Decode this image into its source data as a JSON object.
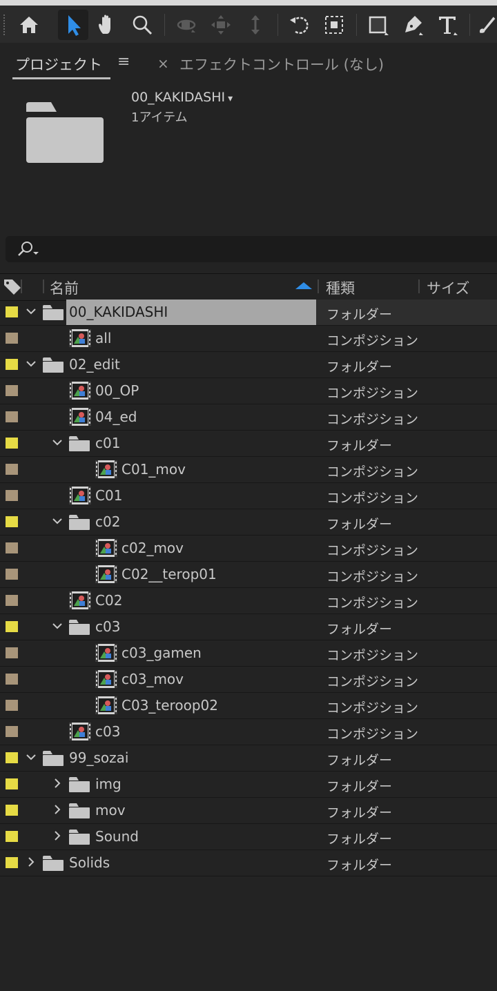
{
  "colors": {
    "label_folder": "#e6db45",
    "label_comp": "#a8957a",
    "accent": "#2f8de6",
    "selection": "#a7a7a7"
  },
  "toolbar": {
    "tools": [
      {
        "name": "home-icon"
      },
      {
        "name": "selection-tool-icon",
        "active": true
      },
      {
        "name": "hand-tool-icon"
      },
      {
        "name": "zoom-tool-icon"
      },
      {
        "name": "orbit-camera-icon"
      },
      {
        "name": "pan-camera-icon"
      },
      {
        "name": "dolly-camera-icon"
      },
      {
        "name": "rotate-tool-icon"
      },
      {
        "name": "pan-behind-icon"
      },
      {
        "name": "rectangle-tool-icon"
      },
      {
        "name": "pen-tool-icon"
      },
      {
        "name": "type-tool-icon"
      },
      {
        "name": "brush-tool-icon"
      }
    ]
  },
  "panel": {
    "project_tab": "プロジェクト",
    "menu_glyph": "≡",
    "close_glyph": "×",
    "effect_tab": "エフェクトコントロール (なし)"
  },
  "info": {
    "name": "00_KAKIDASHI",
    "caret": "▾",
    "count": "1アイテム"
  },
  "columns": {
    "name": "名前",
    "type": "種類",
    "size": "サイズ"
  },
  "rows": [
    {
      "name": "00_KAKIDASHI",
      "type": "フォルダー",
      "kind": "folder",
      "depth": 0,
      "expand": "open",
      "selected": true
    },
    {
      "name": "all",
      "type": "コンポジション",
      "kind": "comp",
      "depth": 1
    },
    {
      "name": "02_edit",
      "type": "フォルダー",
      "kind": "folder",
      "depth": 0,
      "expand": "open"
    },
    {
      "name": "00_OP",
      "type": "コンポジション",
      "kind": "comp",
      "depth": 1
    },
    {
      "name": "04_ed",
      "type": "コンポジション",
      "kind": "comp",
      "depth": 1
    },
    {
      "name": "c01",
      "type": "フォルダー",
      "kind": "folder",
      "depth": 1,
      "expand": "open"
    },
    {
      "name": "C01_mov",
      "type": "コンポジション",
      "kind": "comp",
      "depth": 2
    },
    {
      "name": "C01",
      "type": "コンポジション",
      "kind": "comp",
      "depth": 1
    },
    {
      "name": "c02",
      "type": "フォルダー",
      "kind": "folder",
      "depth": 1,
      "expand": "open"
    },
    {
      "name": "c02_mov",
      "type": "コンポジション",
      "kind": "comp",
      "depth": 2
    },
    {
      "name": "C02__terop01",
      "type": "コンポジション",
      "kind": "comp",
      "depth": 2
    },
    {
      "name": "C02",
      "type": "コンポジション",
      "kind": "comp",
      "depth": 1
    },
    {
      "name": "c03",
      "type": "フォルダー",
      "kind": "folder",
      "depth": 1,
      "expand": "open"
    },
    {
      "name": "c03_gamen",
      "type": "コンポジション",
      "kind": "comp",
      "depth": 2
    },
    {
      "name": "c03_mov",
      "type": "コンポジション",
      "kind": "comp",
      "depth": 2
    },
    {
      "name": "C03_teroop02",
      "type": "コンポジション",
      "kind": "comp",
      "depth": 2
    },
    {
      "name": "c03",
      "type": "コンポジション",
      "kind": "comp",
      "depth": 1
    },
    {
      "name": "99_sozai",
      "type": "フォルダー",
      "kind": "folder",
      "depth": 0,
      "expand": "open"
    },
    {
      "name": "img",
      "type": "フォルダー",
      "kind": "folder",
      "depth": 1,
      "expand": "closed"
    },
    {
      "name": "mov",
      "type": "フォルダー",
      "kind": "folder",
      "depth": 1,
      "expand": "closed"
    },
    {
      "name": "Sound",
      "type": "フォルダー",
      "kind": "folder",
      "depth": 1,
      "expand": "closed"
    },
    {
      "name": "Solids",
      "type": "フォルダー",
      "kind": "folder",
      "depth": 0,
      "expand": "closed"
    }
  ]
}
